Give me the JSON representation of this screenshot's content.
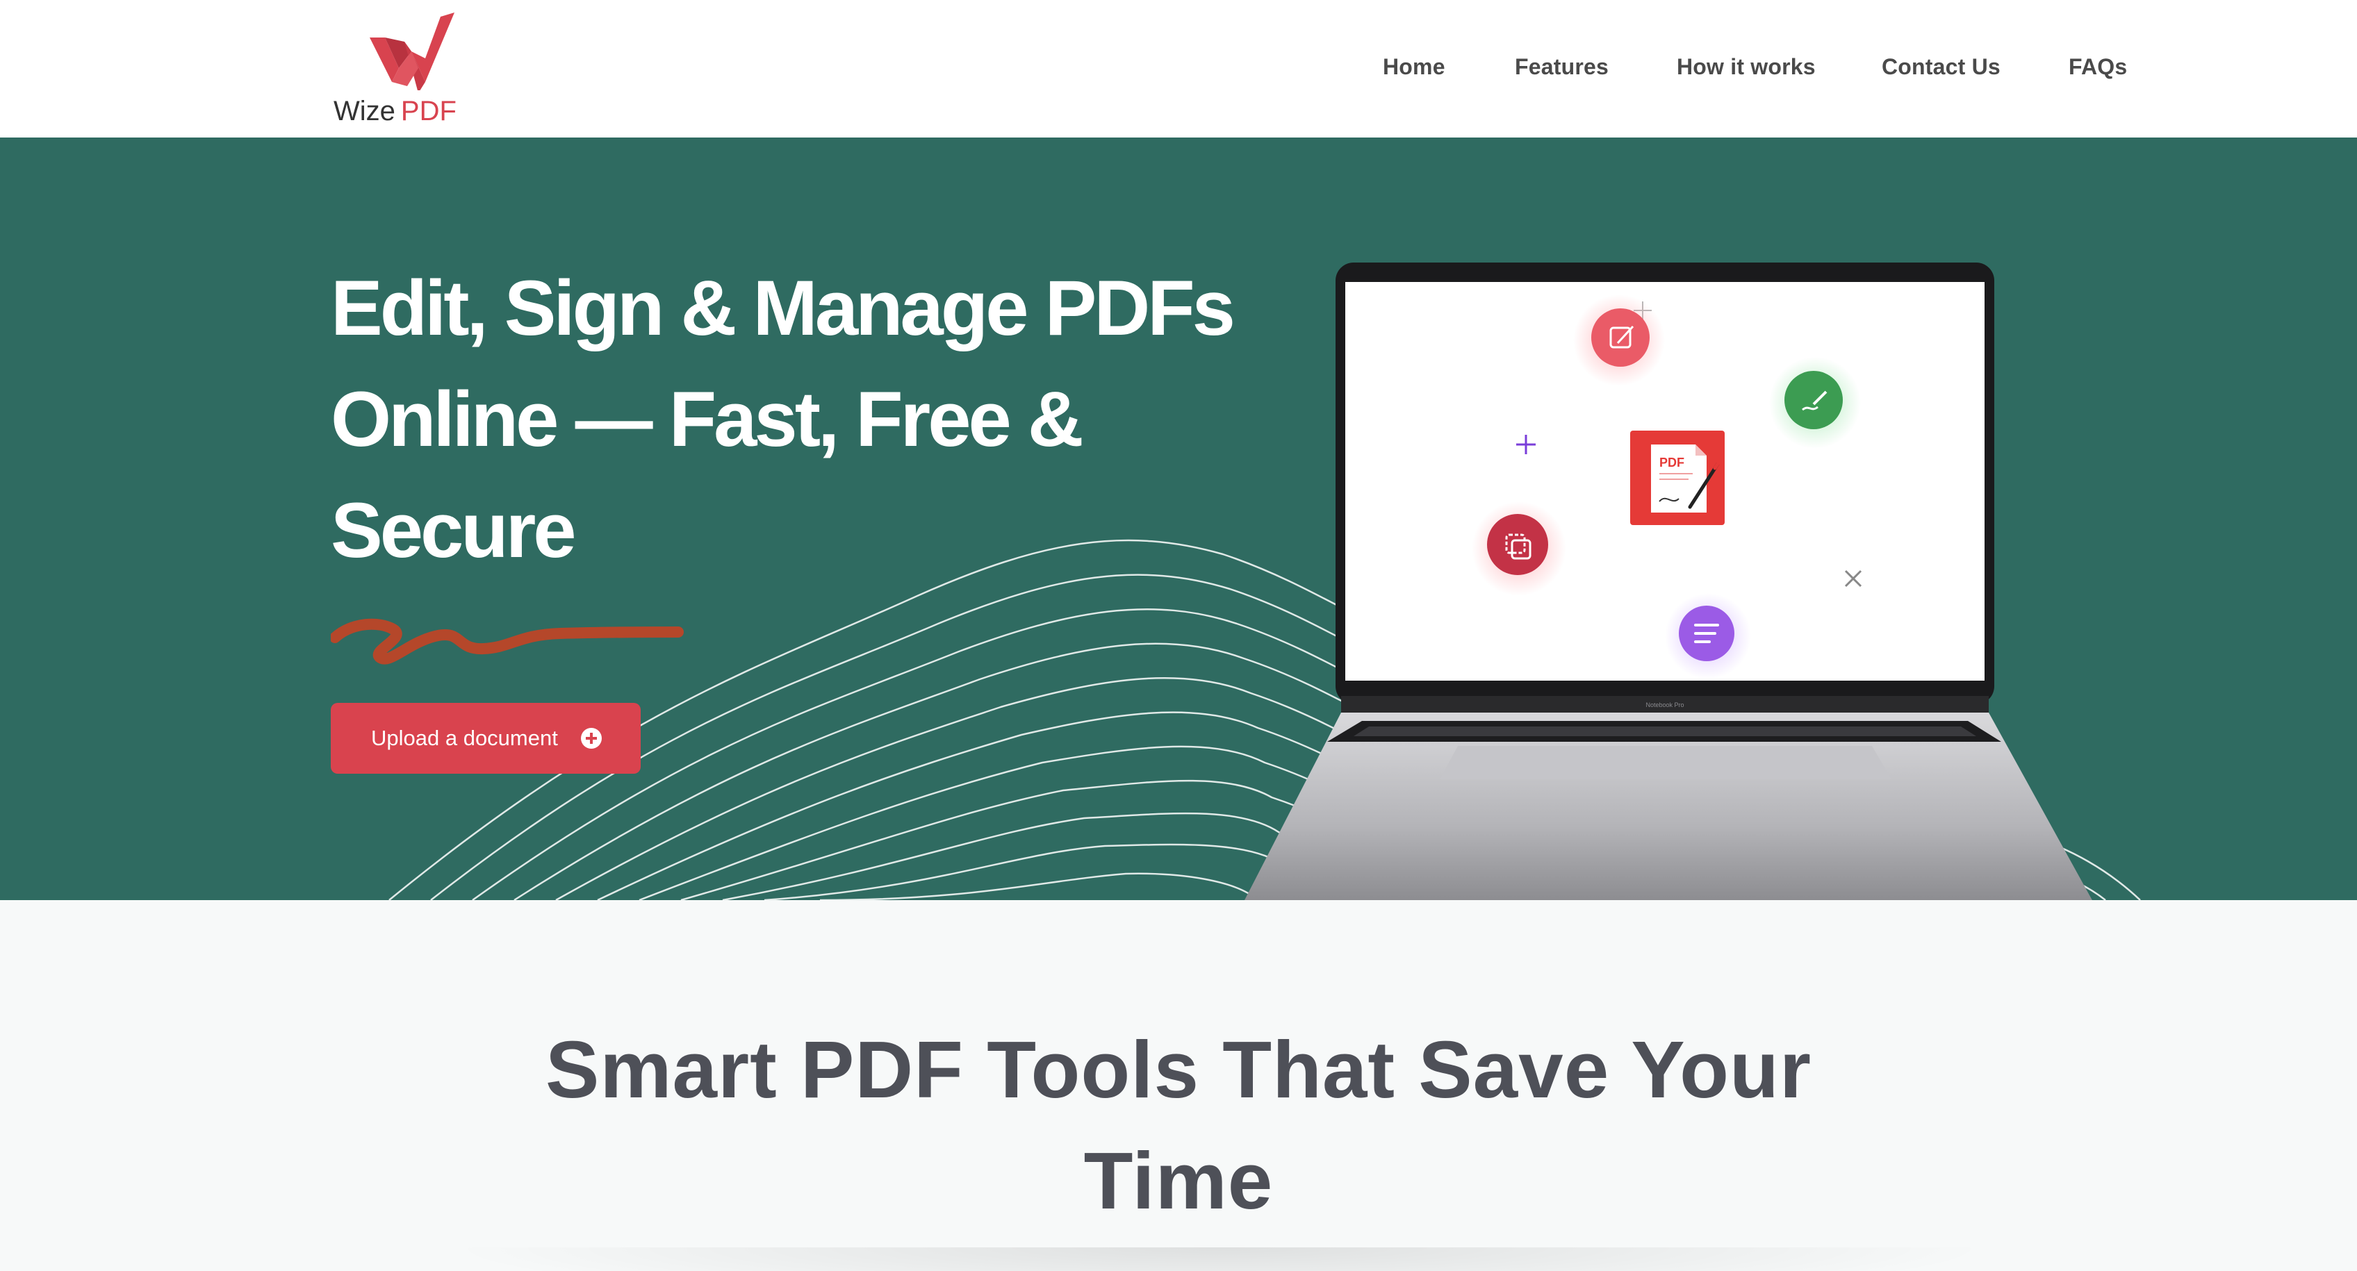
{
  "brand": {
    "name_part1": "Wize",
    "name_part2": "PDF",
    "accent_color": "#d8434f",
    "icon": "wizepdf-logo-icon"
  },
  "nav": {
    "items": [
      {
        "label": "Home"
      },
      {
        "label": "Features"
      },
      {
        "label": "How it works"
      },
      {
        "label": "Contact Us"
      },
      {
        "label": "FAQs"
      }
    ]
  },
  "hero": {
    "background_color": "#2f6b61",
    "headline_lines": [
      "Edit, Sign & Manage PDFs",
      "Online — Fast, Free &",
      "Secure"
    ],
    "upload_button": {
      "label": "Upload a document",
      "icon": "plus-circle-icon",
      "color": "#d9434e"
    },
    "laptop": {
      "center_badge": "PDF",
      "model_label": "Notebook Pro",
      "feature_icons": [
        "edit-icon",
        "sign-icon",
        "copy-icon",
        "list-icon"
      ]
    }
  },
  "tools_section": {
    "title_lines": [
      "Smart PDF Tools That Save Your",
      "Time"
    ]
  }
}
